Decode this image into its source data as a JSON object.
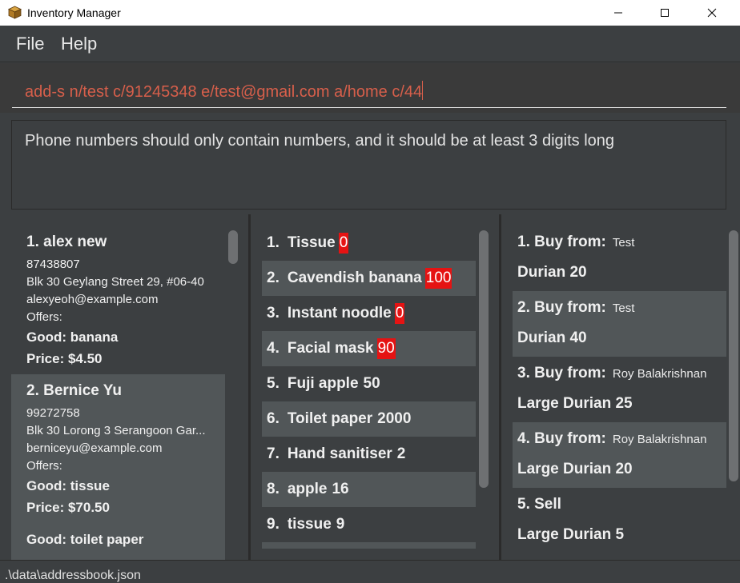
{
  "window": {
    "title": "Inventory Manager"
  },
  "menu": {
    "file": "File",
    "help": "Help"
  },
  "command": {
    "value": "add-s n/test c/91245348 e/test@gmail.com a/home c/44"
  },
  "result": {
    "message": "Phone numbers should only contain numbers, and it should be at least 3 digits long"
  },
  "suppliers": [
    {
      "name": "1.  alex new",
      "phone": "87438807",
      "address": "Blk 30 Geylang Street 29, #06-40",
      "email": "alexyeoh@example.com",
      "offers_label": "Offers:",
      "goods": [
        "Good: banana",
        "Price: $4.50"
      ]
    },
    {
      "name": "2.  Bernice Yu",
      "phone": "99272758",
      "address": "Blk 30 Lorong 3 Serangoon Gar...",
      "email": "berniceyu@example.com",
      "offers_label": "Offers:",
      "goods": [
        "Good: tissue",
        "Price: $70.50",
        "",
        "Good: toilet paper"
      ]
    }
  ],
  "goods": [
    {
      "index": "1.",
      "name": "Tissue",
      "qty": "0",
      "alert": true
    },
    {
      "index": "2.",
      "name": "Cavendish banana",
      "qty": "100",
      "alert": true
    },
    {
      "index": "3.",
      "name": "Instant noodle",
      "qty": "0",
      "alert": true
    },
    {
      "index": "4.",
      "name": "Facial mask",
      "qty": "90",
      "alert": true
    },
    {
      "index": "5.",
      "name": "Fuji apple",
      "qty": "50",
      "alert": false
    },
    {
      "index": "6.",
      "name": "Toilet paper",
      "qty": "2000",
      "alert": false
    },
    {
      "index": "7.",
      "name": "Hand sanitiser",
      "qty": "2",
      "alert": false
    },
    {
      "index": "8.",
      "name": "apple",
      "qty": "16",
      "alert": false
    },
    {
      "index": "9.",
      "name": "tissue",
      "qty": "9",
      "alert": false
    }
  ],
  "transactions": [
    {
      "head": "1.  Buy from:",
      "party": "Test",
      "good": "Durian 20"
    },
    {
      "head": "2.  Buy from:",
      "party": "Test",
      "good": "Durian 40"
    },
    {
      "head": "3.  Buy from:",
      "party": "Roy Balakrishnan",
      "good": "Large Durian 25"
    },
    {
      "head": "4.  Buy from:",
      "party": "Roy Balakrishnan",
      "good": "Large Durian 20"
    },
    {
      "head": "5.  Sell",
      "party": "",
      "good": "Large Durian 5"
    }
  ],
  "status": {
    "path": ".\\data\\addressbook.json"
  },
  "colors": {
    "alert_red": "#e51313",
    "command_text": "#d75f4b",
    "row_alt": "#515658",
    "background": "#3c3f41"
  }
}
